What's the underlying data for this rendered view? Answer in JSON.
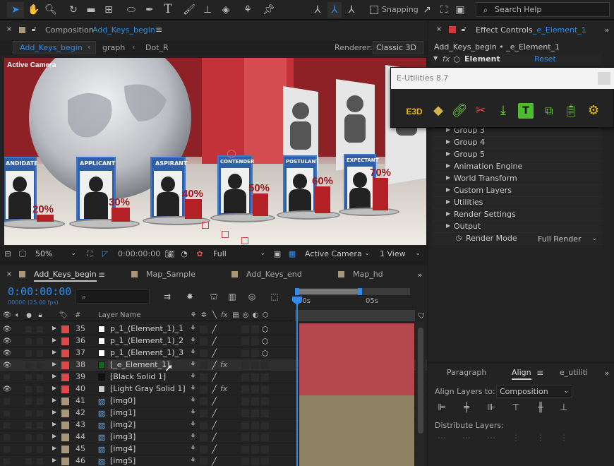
{
  "toolbar": {
    "snapping_label": "Snapping",
    "search_label": "Search Help"
  },
  "composition_panel": {
    "title_prefix": "Composition",
    "title_name": "Add_Keys_begin",
    "breadcrumbs": [
      "Add_Keys_begin",
      "graph",
      "Dot_R"
    ],
    "renderer_label": "Renderer:",
    "renderer_value": "Classic 3D",
    "active_camera_overlay": "Active Camera",
    "candidates": [
      {
        "label": "ANDIDATE",
        "pct": "20%"
      },
      {
        "label": "APPLICANT",
        "pct": "30%"
      },
      {
        "label": "ASPIRANT",
        "pct": "40%"
      },
      {
        "label": "CONTENDER",
        "pct": "50%"
      },
      {
        "label": "POSTULANT",
        "pct": "60%"
      },
      {
        "label": "EXPECTANT",
        "pct": "70%"
      }
    ],
    "footer": {
      "zoom": "50%",
      "timecode": "0:00:00:00",
      "resolution": "Full",
      "camera": "Active Camera",
      "view": "1 View"
    }
  },
  "effect_controls": {
    "title": "Effect Controls",
    "title_layer": "_e_Element_1",
    "subtitle": "Add_Keys_begin • _e_Element_1",
    "fx_label": "fx",
    "effect_name": "Element",
    "reset_label": "Reset",
    "rows": [
      "Group 3",
      "Group 4",
      "Group 5",
      "Animation Engine",
      "World Transform",
      "Custom Layers",
      "Utilities",
      "Render Settings",
      "Output"
    ],
    "render_mode_label": "Render Mode",
    "render_mode_value": "Full Render"
  },
  "e_utilities": {
    "title": "E-Utilities 8.7",
    "icons": [
      "e3d-icon",
      "diamond-icon",
      "link-icon",
      "unlink-icon",
      "download-icon",
      "text-tool-icon",
      "element-select-icon",
      "clipboard-icon",
      "gear-icon"
    ]
  },
  "timeline": {
    "tabs": [
      "Add_Keys_begin",
      "Map_Sample",
      "Add_Keys_end",
      "Map_hd"
    ],
    "timecode": "0:00:00:00",
    "timecode_sub": "00000 (25.00 fps)",
    "search_placeholder": "",
    "col_number": "#",
    "col_layer_name": "Layer Name",
    "ruler_marks": [
      "00s",
      "05s"
    ],
    "layers": [
      {
        "num": "35",
        "name": "p_1_(Element_1)_1",
        "color": "#e04848",
        "swatch": "#ffffff",
        "fx": "",
        "eye": true,
        "bar": "#b5484e"
      },
      {
        "num": "36",
        "name": "p_1_(Element_1)_2",
        "color": "#e04848",
        "swatch": "#ffffff",
        "fx": "",
        "eye": true,
        "bar": "#b5484e"
      },
      {
        "num": "37",
        "name": "p_1_(Element_1)_3",
        "color": "#e04848",
        "swatch": "#ffffff",
        "fx": "",
        "eye": true,
        "bar": "#b5484e"
      },
      {
        "num": "38",
        "name": "[_e_Element_1]",
        "color": "#e04848",
        "swatch": "#0b6b1b",
        "fx": "fx",
        "eye": true,
        "bar": "#b5484e"
      },
      {
        "num": "39",
        "name": "[Black Solid 1]",
        "color": "#e04848",
        "swatch": "#111111",
        "fx": "",
        "eye": false,
        "bar": "#b5484e"
      },
      {
        "num": "40",
        "name": "[Light Gray Solid 1]",
        "color": "#e04848",
        "swatch": "#cccccc",
        "fx": "fx",
        "eye": true,
        "bar": "#b5484e"
      },
      {
        "num": "41",
        "name": "[img0]",
        "color": "#a89878",
        "swatch": "",
        "fx": "",
        "eye": false,
        "bar": "#8e8262"
      },
      {
        "num": "42",
        "name": "[img1]",
        "color": "#a89878",
        "swatch": "",
        "fx": "",
        "eye": false,
        "bar": "#8e8262"
      },
      {
        "num": "43",
        "name": "[img2]",
        "color": "#a89878",
        "swatch": "",
        "fx": "",
        "eye": false,
        "bar": "#8e8262"
      },
      {
        "num": "44",
        "name": "[img3]",
        "color": "#a89878",
        "swatch": "",
        "fx": "",
        "eye": false,
        "bar": "#8e8262"
      },
      {
        "num": "45",
        "name": "[img4]",
        "color": "#a89878",
        "swatch": "",
        "fx": "",
        "eye": false,
        "bar": "#8e8262"
      },
      {
        "num": "46",
        "name": "[img5]",
        "color": "#a89878",
        "swatch": "",
        "fx": "",
        "eye": false,
        "bar": "#8e8262"
      }
    ]
  },
  "align_panel": {
    "tabs": [
      "Paragraph",
      "Align",
      "e_utiliti"
    ],
    "align_to_label": "Align Layers to:",
    "align_to_value": "Composition",
    "distribute_label": "Distribute Layers:"
  },
  "colors": {
    "accent": "#2d8ceb",
    "panel": "#232323",
    "red_bar": "#b5484e",
    "tan_bar": "#8e8262"
  }
}
